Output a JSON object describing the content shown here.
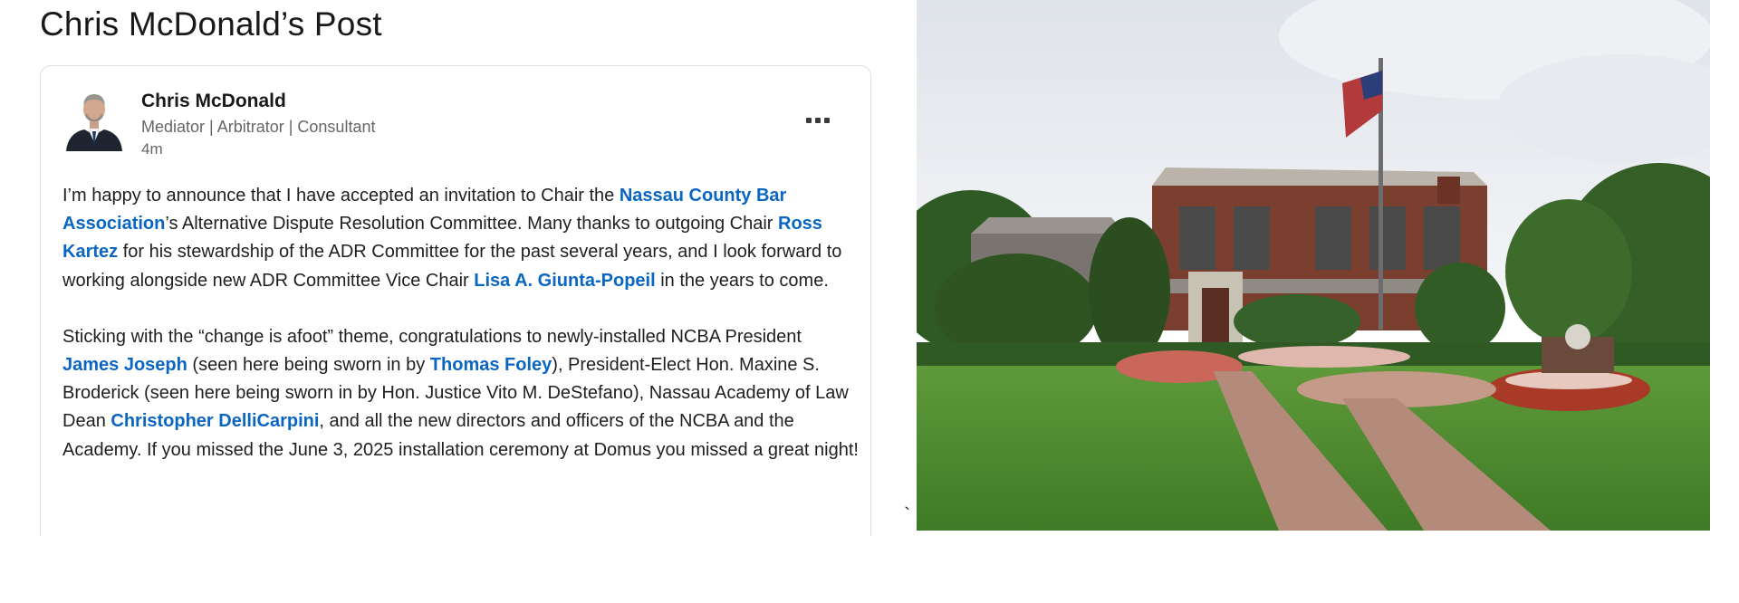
{
  "page": {
    "title": "Chris McDonald’s Post"
  },
  "post": {
    "author": {
      "name": "Chris McDonald",
      "headline": "Mediator | Arbitrator | Consultant",
      "time": "4m"
    },
    "menu_icon": "more-horizontal-icon",
    "body": {
      "p1": {
        "t1": "I’m happy to announce that I have accepted an invitation to Chair the ",
        "m1": "Nassau County Bar Association",
        "t2": "’s Alternative Dispute Resolution Committee. Many thanks to outgoing Chair ",
        "m2": "Ross Kartez",
        "t3": " for his stewardship of the ADR Committee for the past several years, and I look forward to working alongside new ADR Committee Vice Chair ",
        "m3": "Lisa A. Giunta-Popeil",
        "t4": " in the years to come."
      },
      "p2": {
        "t1": "Sticking with the “change is afoot” theme, congratulations to newly-installed NCBA President ",
        "m1": "James Joseph",
        "t2": " (seen here being sworn in by ",
        "m2": "Thomas Foley",
        "t3": "), President-Elect Hon. Maxine S. Broderick (seen here being sworn in by Hon. Justice Vito M. DeStefano), Nassau Academy of Law Dean ",
        "m3": "Christopher DelliCarpini",
        "t4": ", and all the new directors and officers of the NCBA and the Academy. If you missed the June 3, 2025 installation ceremony at Domus you missed a great night!"
      }
    },
    "stray_mark": "`"
  },
  "colors": {
    "link": "#0a66c2",
    "text": "#1f1f1f",
    "muted": "#666666",
    "border": "#e0dfdc"
  }
}
